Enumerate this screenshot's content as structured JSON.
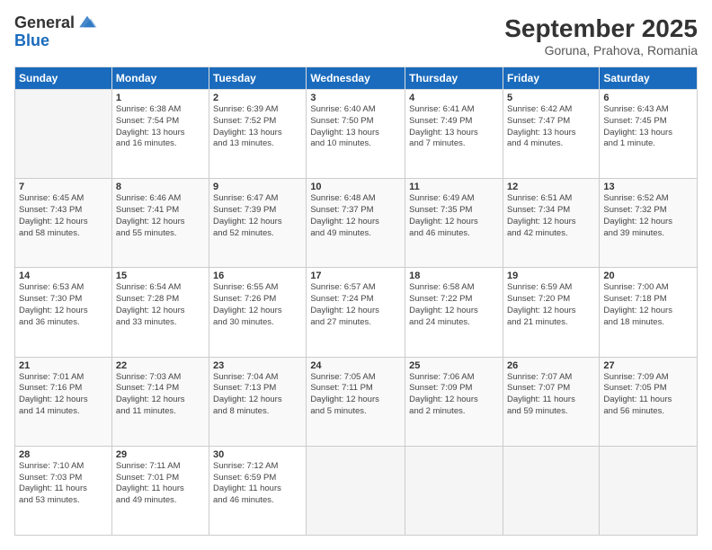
{
  "logo": {
    "general": "General",
    "blue": "Blue"
  },
  "title": "September 2025",
  "subtitle": "Goruna, Prahova, Romania",
  "days_header": [
    "Sunday",
    "Monday",
    "Tuesday",
    "Wednesday",
    "Thursday",
    "Friday",
    "Saturday"
  ],
  "weeks": [
    [
      {
        "day": "",
        "info": ""
      },
      {
        "day": "1",
        "info": "Sunrise: 6:38 AM\nSunset: 7:54 PM\nDaylight: 13 hours\nand 16 minutes."
      },
      {
        "day": "2",
        "info": "Sunrise: 6:39 AM\nSunset: 7:52 PM\nDaylight: 13 hours\nand 13 minutes."
      },
      {
        "day": "3",
        "info": "Sunrise: 6:40 AM\nSunset: 7:50 PM\nDaylight: 13 hours\nand 10 minutes."
      },
      {
        "day": "4",
        "info": "Sunrise: 6:41 AM\nSunset: 7:49 PM\nDaylight: 13 hours\nand 7 minutes."
      },
      {
        "day": "5",
        "info": "Sunrise: 6:42 AM\nSunset: 7:47 PM\nDaylight: 13 hours\nand 4 minutes."
      },
      {
        "day": "6",
        "info": "Sunrise: 6:43 AM\nSunset: 7:45 PM\nDaylight: 13 hours\nand 1 minute."
      }
    ],
    [
      {
        "day": "7",
        "info": "Sunrise: 6:45 AM\nSunset: 7:43 PM\nDaylight: 12 hours\nand 58 minutes."
      },
      {
        "day": "8",
        "info": "Sunrise: 6:46 AM\nSunset: 7:41 PM\nDaylight: 12 hours\nand 55 minutes."
      },
      {
        "day": "9",
        "info": "Sunrise: 6:47 AM\nSunset: 7:39 PM\nDaylight: 12 hours\nand 52 minutes."
      },
      {
        "day": "10",
        "info": "Sunrise: 6:48 AM\nSunset: 7:37 PM\nDaylight: 12 hours\nand 49 minutes."
      },
      {
        "day": "11",
        "info": "Sunrise: 6:49 AM\nSunset: 7:35 PM\nDaylight: 12 hours\nand 46 minutes."
      },
      {
        "day": "12",
        "info": "Sunrise: 6:51 AM\nSunset: 7:34 PM\nDaylight: 12 hours\nand 42 minutes."
      },
      {
        "day": "13",
        "info": "Sunrise: 6:52 AM\nSunset: 7:32 PM\nDaylight: 12 hours\nand 39 minutes."
      }
    ],
    [
      {
        "day": "14",
        "info": "Sunrise: 6:53 AM\nSunset: 7:30 PM\nDaylight: 12 hours\nand 36 minutes."
      },
      {
        "day": "15",
        "info": "Sunrise: 6:54 AM\nSunset: 7:28 PM\nDaylight: 12 hours\nand 33 minutes."
      },
      {
        "day": "16",
        "info": "Sunrise: 6:55 AM\nSunset: 7:26 PM\nDaylight: 12 hours\nand 30 minutes."
      },
      {
        "day": "17",
        "info": "Sunrise: 6:57 AM\nSunset: 7:24 PM\nDaylight: 12 hours\nand 27 minutes."
      },
      {
        "day": "18",
        "info": "Sunrise: 6:58 AM\nSunset: 7:22 PM\nDaylight: 12 hours\nand 24 minutes."
      },
      {
        "day": "19",
        "info": "Sunrise: 6:59 AM\nSunset: 7:20 PM\nDaylight: 12 hours\nand 21 minutes."
      },
      {
        "day": "20",
        "info": "Sunrise: 7:00 AM\nSunset: 7:18 PM\nDaylight: 12 hours\nand 18 minutes."
      }
    ],
    [
      {
        "day": "21",
        "info": "Sunrise: 7:01 AM\nSunset: 7:16 PM\nDaylight: 12 hours\nand 14 minutes."
      },
      {
        "day": "22",
        "info": "Sunrise: 7:03 AM\nSunset: 7:14 PM\nDaylight: 12 hours\nand 11 minutes."
      },
      {
        "day": "23",
        "info": "Sunrise: 7:04 AM\nSunset: 7:13 PM\nDaylight: 12 hours\nand 8 minutes."
      },
      {
        "day": "24",
        "info": "Sunrise: 7:05 AM\nSunset: 7:11 PM\nDaylight: 12 hours\nand 5 minutes."
      },
      {
        "day": "25",
        "info": "Sunrise: 7:06 AM\nSunset: 7:09 PM\nDaylight: 12 hours\nand 2 minutes."
      },
      {
        "day": "26",
        "info": "Sunrise: 7:07 AM\nSunset: 7:07 PM\nDaylight: 11 hours\nand 59 minutes."
      },
      {
        "day": "27",
        "info": "Sunrise: 7:09 AM\nSunset: 7:05 PM\nDaylight: 11 hours\nand 56 minutes."
      }
    ],
    [
      {
        "day": "28",
        "info": "Sunrise: 7:10 AM\nSunset: 7:03 PM\nDaylight: 11 hours\nand 53 minutes."
      },
      {
        "day": "29",
        "info": "Sunrise: 7:11 AM\nSunset: 7:01 PM\nDaylight: 11 hours\nand 49 minutes."
      },
      {
        "day": "30",
        "info": "Sunrise: 7:12 AM\nSunset: 6:59 PM\nDaylight: 11 hours\nand 46 minutes."
      },
      {
        "day": "",
        "info": ""
      },
      {
        "day": "",
        "info": ""
      },
      {
        "day": "",
        "info": ""
      },
      {
        "day": "",
        "info": ""
      }
    ]
  ]
}
